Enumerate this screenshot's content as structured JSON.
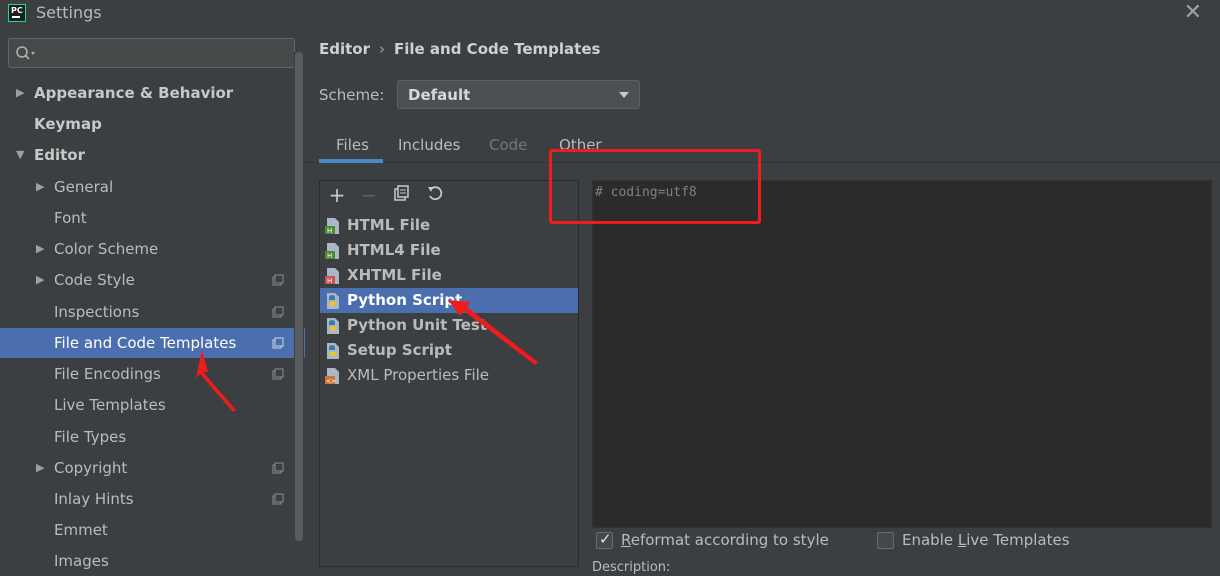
{
  "window": {
    "title": "Settings",
    "app_icon_label": "PC"
  },
  "search": {
    "placeholder": ""
  },
  "sidebar": {
    "items": [
      {
        "label": "Appearance & Behavior",
        "bold": true,
        "expanded": false
      },
      {
        "label": "Keymap",
        "bold": true
      },
      {
        "label": "Editor",
        "bold": true,
        "expanded": true
      },
      {
        "label": "General",
        "expanded": false
      },
      {
        "label": "Font"
      },
      {
        "label": "Color Scheme",
        "expanded": false
      },
      {
        "label": "Code Style",
        "expanded": false,
        "has_copy_icon": true
      },
      {
        "label": "Inspections",
        "has_copy_icon": true
      },
      {
        "label": "File and Code Templates",
        "selected": true,
        "has_copy_icon": true
      },
      {
        "label": "File Encodings",
        "has_copy_icon": true
      },
      {
        "label": "Live Templates"
      },
      {
        "label": "File Types"
      },
      {
        "label": "Copyright",
        "expanded": false,
        "has_copy_icon": true
      },
      {
        "label": "Inlay Hints",
        "has_copy_icon": true
      },
      {
        "label": "Emmet"
      },
      {
        "label": "Images"
      }
    ]
  },
  "breadcrumb": {
    "parent": "Editor",
    "separator": "›",
    "current": "File and Code Templates"
  },
  "scheme": {
    "label": "Scheme:",
    "value": "Default"
  },
  "tabs": [
    {
      "label": "Files",
      "active": true
    },
    {
      "label": "Includes"
    },
    {
      "label": "Code",
      "disabled": true
    },
    {
      "label": "Other"
    }
  ],
  "toolbar": {
    "add": "+",
    "remove": "−",
    "copy": "copy",
    "reset": "reset"
  },
  "file_list": [
    {
      "label": "HTML File",
      "icon": "html-file-icon",
      "bold": true
    },
    {
      "label": "HTML4 File",
      "icon": "html-file-icon",
      "bold": true
    },
    {
      "label": "XHTML File",
      "icon": "xhtml-file-icon",
      "bold": true
    },
    {
      "label": "Python Script",
      "icon": "python-file-icon",
      "bold": true,
      "selected": true
    },
    {
      "label": "Python Unit Test",
      "icon": "python-file-icon",
      "bold": true
    },
    {
      "label": "Setup Script",
      "icon": "python-file-icon",
      "bold": true
    },
    {
      "label": "XML Properties File",
      "icon": "xml-file-icon",
      "bold": false
    }
  ],
  "editor": {
    "content": "# coding=utf8"
  },
  "options": {
    "reformat": {
      "label_pre": "",
      "mnemonic": "R",
      "label_post": "eformat according to style",
      "checked": true
    },
    "live_templates": {
      "label_pre": "Enable ",
      "mnemonic": "L",
      "label_post": "ive Templates",
      "checked": false
    }
  },
  "description_label": "Description:",
  "colors": {
    "background": "#3c3f41",
    "selection": "#4b6eaf",
    "editor_bg": "#2b2b2b",
    "tab_underline": "#4a88c7",
    "annotation_red": "#ee1c1c"
  }
}
